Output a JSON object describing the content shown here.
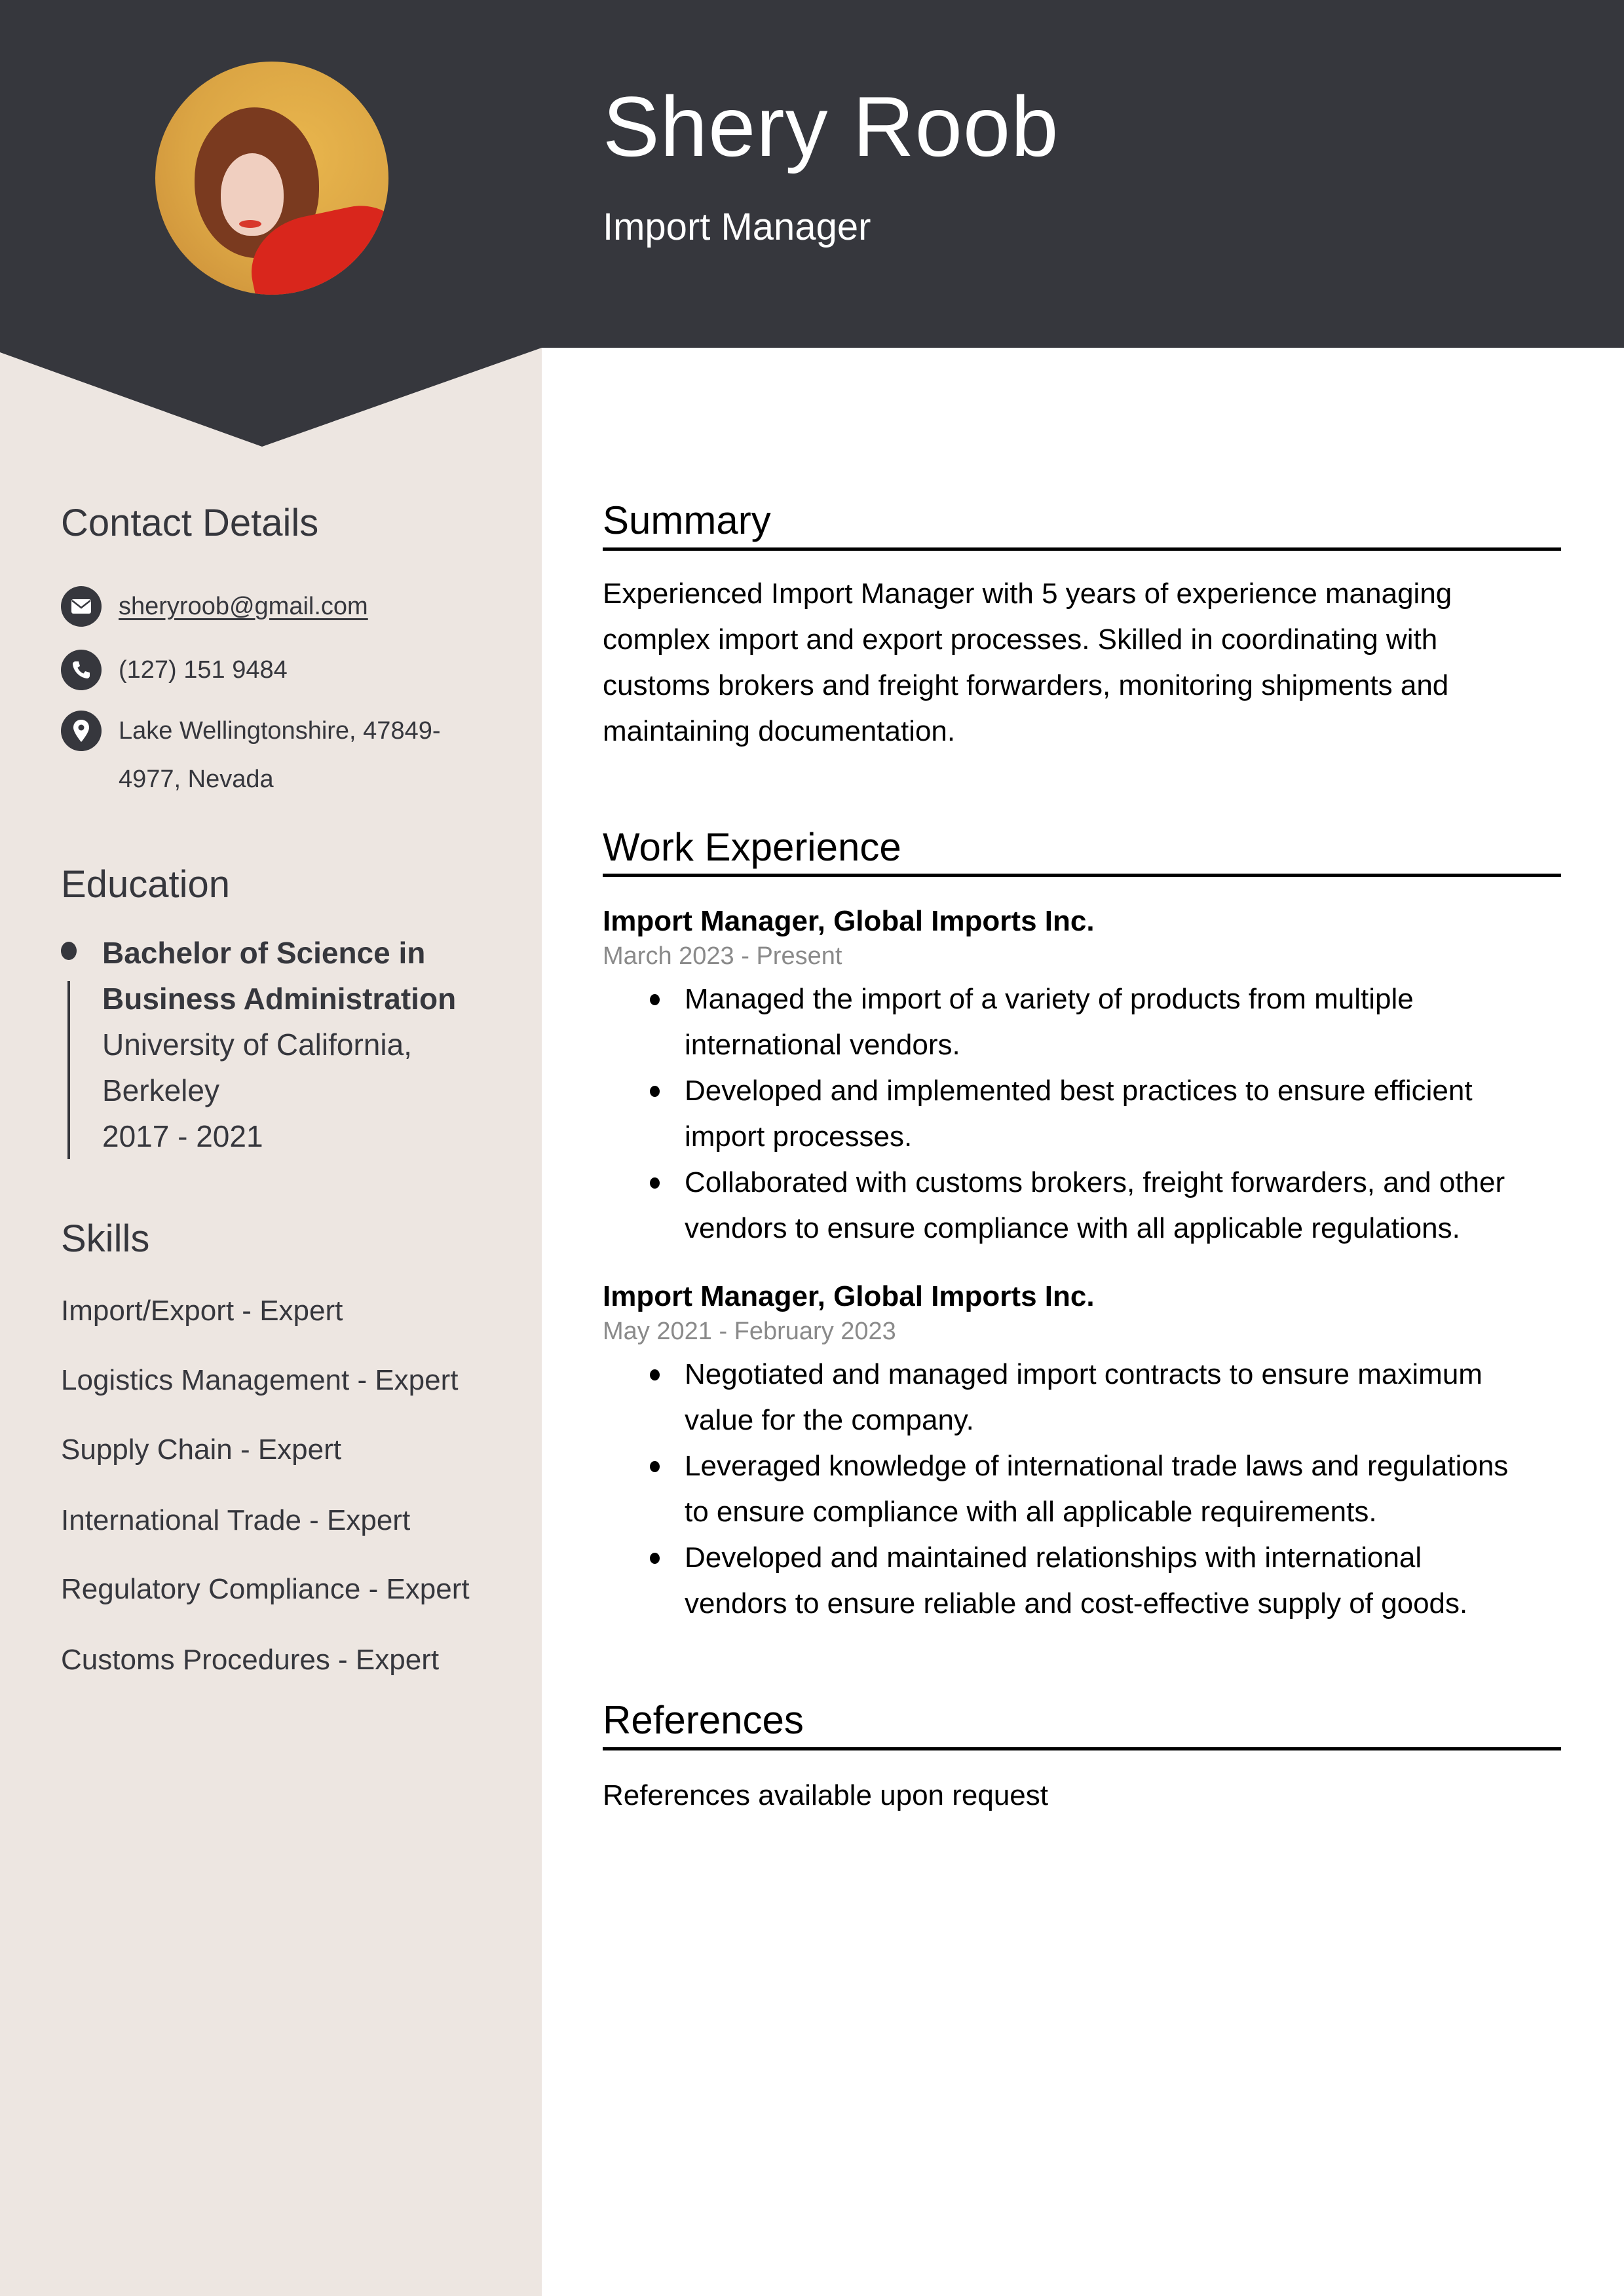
{
  "header": {
    "name": "Shery Roob",
    "job_title": "Import Manager",
    "photo_alt": "profile-photo"
  },
  "sidebar": {
    "contact": {
      "heading": "Contact Details",
      "email": "sheryroob@gmail.com",
      "phone": "(127) 151 9484",
      "address_line1": "Lake Wellingtonshire, 47849-",
      "address_line2": "4977, Nevada",
      "icons": [
        "envelope-icon",
        "phone-icon",
        "map-pin-icon"
      ]
    },
    "education": {
      "heading": "Education",
      "entries": [
        {
          "degree_line1": "Bachelor of Science in",
          "degree_line2": "Business Administration",
          "school_line1": "University of California,",
          "school_line2": "Berkeley",
          "years": "2017 - 2021"
        }
      ]
    },
    "skills": {
      "heading": "Skills",
      "items": [
        "Import/Export - Expert",
        "Logistics Management - Expert",
        "Supply Chain - Expert",
        "International Trade - Expert",
        "Regulatory Compliance - Expert",
        "Customs Procedures - Expert"
      ]
    }
  },
  "main": {
    "summary": {
      "heading": "Summary",
      "lines": [
        "Experienced Import Manager with 5 years of experience managing",
        "complex import and export processes. Skilled in coordinating with",
        "customs brokers and freight forwarders, monitoring shipments and",
        "maintaining documentation."
      ]
    },
    "work": {
      "heading": "Work Experience",
      "jobs": [
        {
          "title": "Import Manager, Global Imports Inc.",
          "dates": "March 2023 - Present",
          "bullets": [
            [
              "Managed the import of a variety of products from multiple",
              "international vendors."
            ],
            [
              "Developed and implemented best practices to ensure efficient",
              "import processes."
            ],
            [
              "Collaborated with customs brokers, freight forwarders, and other",
              "vendors to ensure compliance with all applicable regulations."
            ]
          ]
        },
        {
          "title": "Import Manager, Global Imports Inc.",
          "dates": "May 2021 - February 2023",
          "bullets": [
            [
              "Negotiated and managed import contracts to ensure maximum",
              "value for the company."
            ],
            [
              "Leveraged knowledge of international trade laws and regulations",
              "to ensure compliance with all applicable requirements."
            ],
            [
              "Developed and maintained relationships with international",
              "vendors to ensure reliable and cost-effective supply of goods."
            ]
          ]
        }
      ]
    },
    "references": {
      "heading": "References",
      "text": "References available upon request"
    }
  },
  "colors": {
    "header_bg": "#36373d",
    "sidebar_bg": "#ede6e1",
    "text_dark": "#36373d",
    "date_gray": "#8a8a8a"
  }
}
